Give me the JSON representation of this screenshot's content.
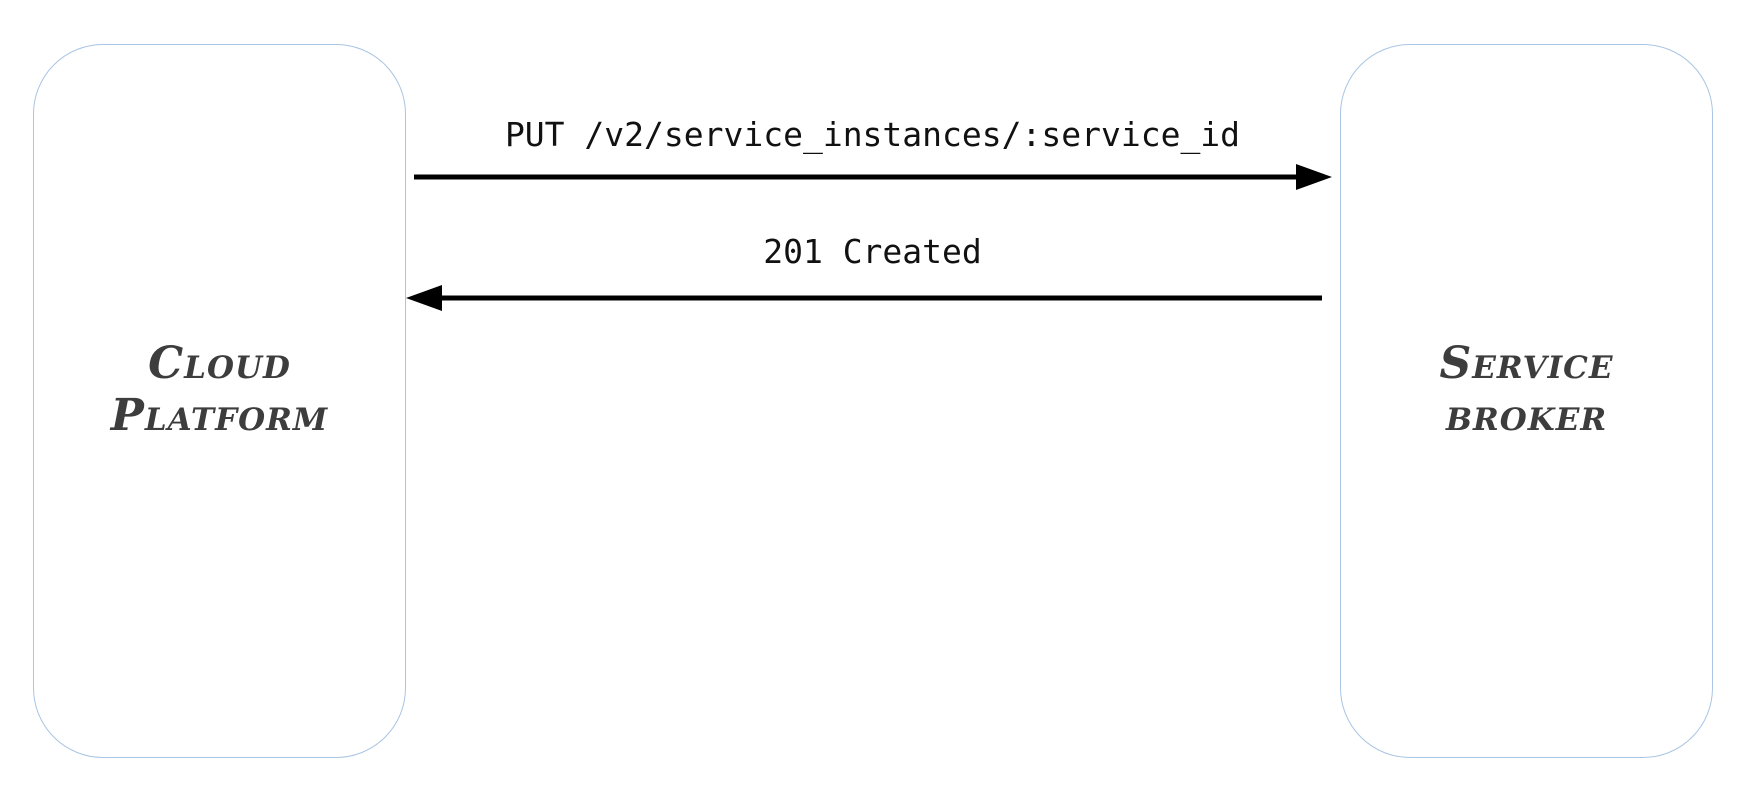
{
  "nodes": {
    "left": {
      "line1": "Cloud",
      "line2": "Platform"
    },
    "right": {
      "line1": "Service",
      "line2": "broker"
    }
  },
  "messages": {
    "request": {
      "label": "PUT /v2/service_instances/:service_id",
      "direction": "left-to-right"
    },
    "response": {
      "label": "201 Created",
      "direction": "right-to-left"
    }
  },
  "colors": {
    "node_border": "#a9c5e3",
    "node_text": "#3d3d3d",
    "arrow": "#000000"
  }
}
